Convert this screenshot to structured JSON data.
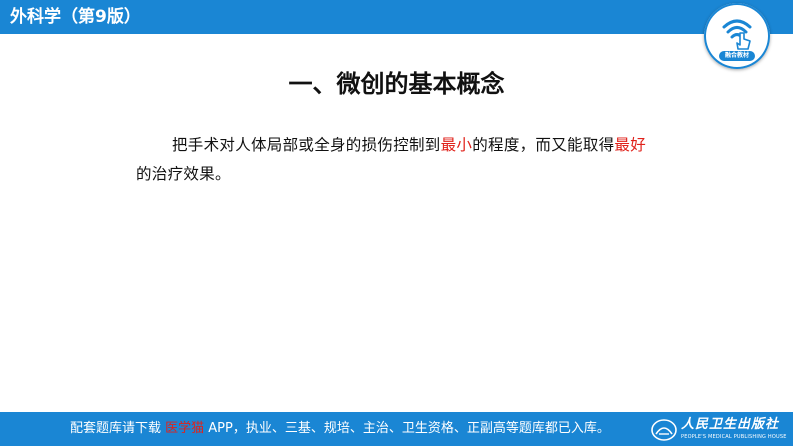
{
  "header": {
    "book_title": "外科学（第9版）",
    "badge_label": "融合教材",
    "icon": "tap-wifi-icon"
  },
  "slide": {
    "title": "一、微创的基本概念",
    "body": {
      "seg1": "把手术对人体局部或全身的损伤控制到",
      "hl1": "最小",
      "seg2": "的程度，而又能取得",
      "hl2": "最好",
      "seg3": "的治疗效果。"
    }
  },
  "footer": {
    "prefix": "配套题库请下载 ",
    "app_name": "医学猫",
    "suffix": " APP，执业、三基、规培、主治、卫生资格、正副高等题库都已入库。",
    "publisher_name": "人民卫生出版社",
    "publisher_sub": "PEOPLE'S MEDICAL PUBLISHING HOUSE"
  },
  "colors": {
    "brand_blue": "#1a86d4",
    "highlight_red": "#e0221b",
    "text": "#111111"
  }
}
